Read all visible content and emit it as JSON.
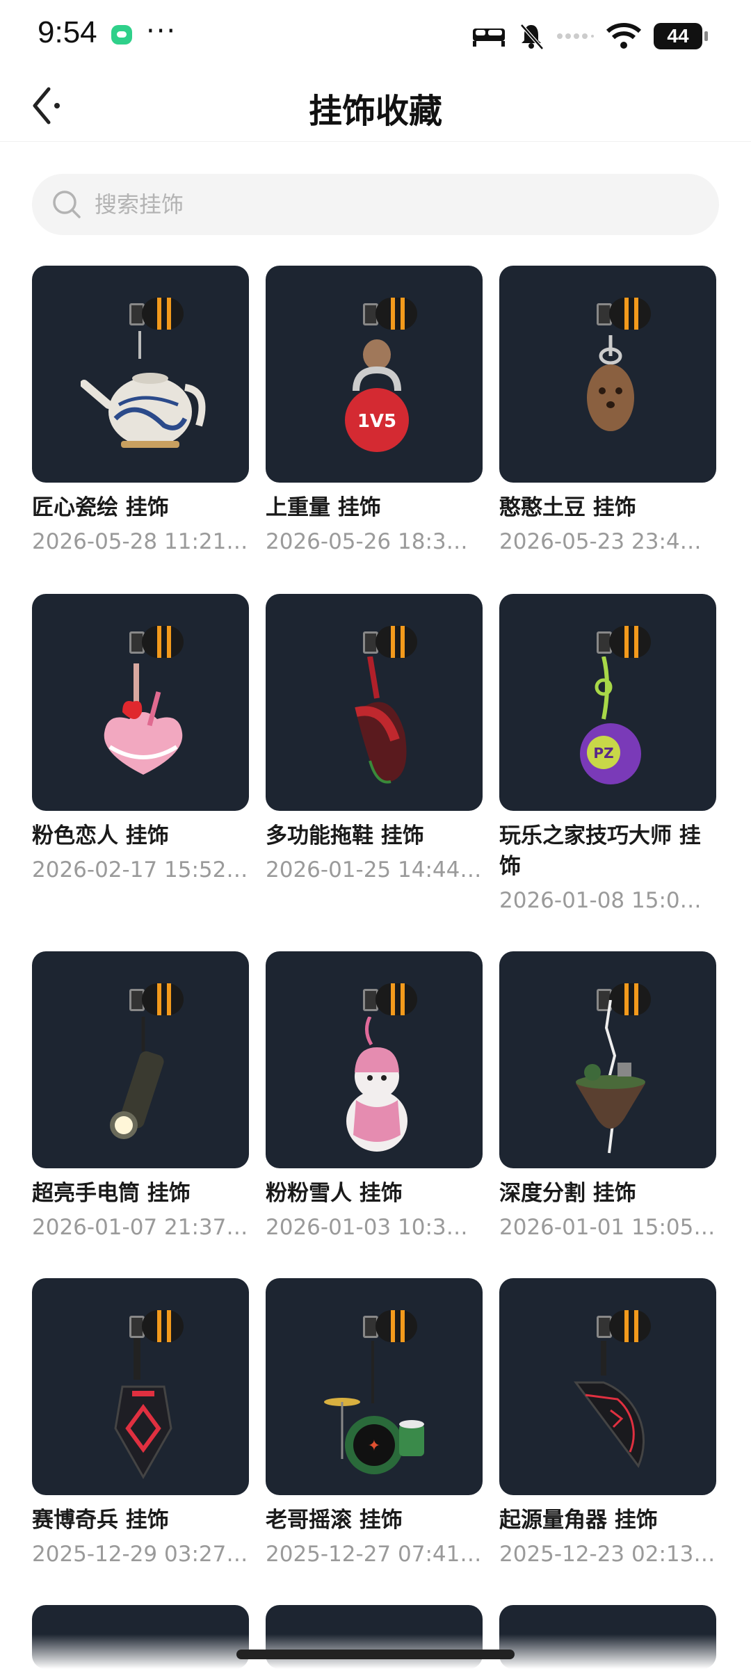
{
  "status_bar": {
    "time": "9:54",
    "dots": "···",
    "battery": "44",
    "icons": [
      "chat-app-icon",
      "bed-icon",
      "mute-bell-icon",
      "signal-icon",
      "wifi-icon",
      "battery-icon"
    ]
  },
  "header": {
    "title": "挂饰收藏",
    "back_icon": "chevron-left-icon"
  },
  "search": {
    "placeholder": "搜索挂饰",
    "value": ""
  },
  "items": [
    {
      "name": "匠心瓷绘 挂饰",
      "date": "2026-05-28 11:21:…",
      "icon": "teapot-charm"
    },
    {
      "name": " 上重量 挂饰",
      "date": "2026-05-26 18:3…",
      "icon": "kettlebell-charm"
    },
    {
      "name": "憨憨土豆 挂饰",
      "date": "2026-05-23 23:4…",
      "icon": "potato-charm"
    },
    {
      "name": "粉色恋人 挂饰",
      "date": "2026-02-17 15:52…",
      "icon": "heart-cake-charm"
    },
    {
      "name": "多功能拖鞋 挂饰",
      "date": "2026-01-25 14:44…",
      "icon": "slipper-charm"
    },
    {
      "name": "玩乐之家技巧大师 挂饰",
      "date": "2026-01-08 15:0…",
      "icon": "yoyo-charm"
    },
    {
      "name": "超亮手电筒 挂饰",
      "date": "2026-01-07 21:37…",
      "icon": "flashlight-charm"
    },
    {
      "name": "粉粉雪人 挂饰",
      "date": "2026-01-03 10:3…",
      "icon": "snowman-charm"
    },
    {
      "name": "深度分割 挂饰",
      "date": "2026-01-01 15:05…",
      "icon": "floating-island-charm"
    },
    {
      "name": "赛博奇兵 挂饰",
      "date": "2025-12-29 03:27…",
      "icon": "cyber-tag-charm"
    },
    {
      "name": "老哥摇滚 挂饰",
      "date": "2025-12-27 07:41:…",
      "icon": "drum-kit-charm"
    },
    {
      "name": "起源量角器 挂饰",
      "date": "2025-12-23 02:13…",
      "icon": "protractor-charm"
    }
  ],
  "colors": {
    "card_bg": "#1d2531",
    "accent_band": "#f39a1c",
    "search_bg": "#f4f4f4",
    "date_text": "#9a9a9a"
  }
}
